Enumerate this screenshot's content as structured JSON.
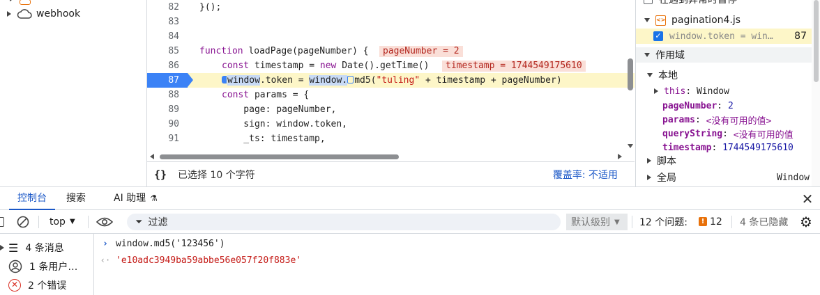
{
  "navigator": {
    "items": [
      {
        "label": "webhook",
        "icon": "cloud-icon",
        "expanded": false
      }
    ]
  },
  "editor": {
    "lines": [
      {
        "num": "82",
        "code": "}();"
      },
      {
        "num": "83",
        "code": ""
      },
      {
        "num": "84",
        "code": ""
      },
      {
        "num": "85",
        "kw": "function",
        "rest": " loadPage(pageNumber) {",
        "inline": "pageNumber = 2"
      },
      {
        "num": "86",
        "kw": "const",
        "rest_a": " timestamp = ",
        "kw2": "new",
        "rest_b": " Date().getTime()",
        "inline": "timestamp = 1744549175610"
      },
      {
        "num": "87",
        "p1": "window",
        "p2": ".token = ",
        "p3": "window.",
        "p4": "md5",
        "p5": "(",
        "s1": "\"tuling\"",
        "p6": " + timestamp + pageNumber)"
      },
      {
        "num": "88",
        "kw": "const",
        "rest": " params = {"
      },
      {
        "num": "89",
        "code": "    page: pageNumber,"
      },
      {
        "num": "90",
        "code": "    sign: window.token,"
      },
      {
        "num": "91",
        "code": "    _ts: timestamp,"
      }
    ],
    "status": {
      "selection": "已选择 10 个字符",
      "coverage": "覆盖率: 不适用"
    }
  },
  "debugger": {
    "top_partial": "在遇到异常时暂停",
    "breakpoint_file": "pagination4.js",
    "breakpoint_code": "window.token = win…",
    "breakpoint_line": "87",
    "scope_title": "作用域",
    "local_title": "本地",
    "this_label": "this",
    "this_value": "Window",
    "vars": [
      {
        "key": "pageNumber",
        "value": "2",
        "kind": "num"
      },
      {
        "key": "params",
        "value": "<没有可用的值>",
        "kind": "na"
      },
      {
        "key": "queryString",
        "value": "<没有可用的值",
        "kind": "na"
      },
      {
        "key": "timestamp",
        "value": "1744549175610",
        "kind": "num"
      }
    ],
    "script_title": "脚本",
    "global_title": "全局",
    "global_value": "Window"
  },
  "drawer": {
    "tabs": [
      "控制台",
      "搜索",
      "AI 助理"
    ],
    "active_tab": 0
  },
  "console_toolbar": {
    "context": "top",
    "filter_placeholder": "过滤",
    "levels": "默认级别",
    "issues_label": "12 个问题:",
    "issues_count": "12",
    "hidden": "4 条已隐藏"
  },
  "console_sidebar": [
    {
      "label": "4 条消息",
      "icon": "list-icon"
    },
    {
      "label": "1 条用户…",
      "icon": "user-icon"
    },
    {
      "label": "2 个错误",
      "icon": "error-icon"
    }
  ],
  "console_output": {
    "input": "window.md5('123456')",
    "result": "'e10adc3949ba59abbe56e057f20f883e'"
  },
  "colors": {
    "accent": "#1a57c7",
    "breakpoint": "#3b82f6",
    "paused_line": "#fdf6c8"
  }
}
